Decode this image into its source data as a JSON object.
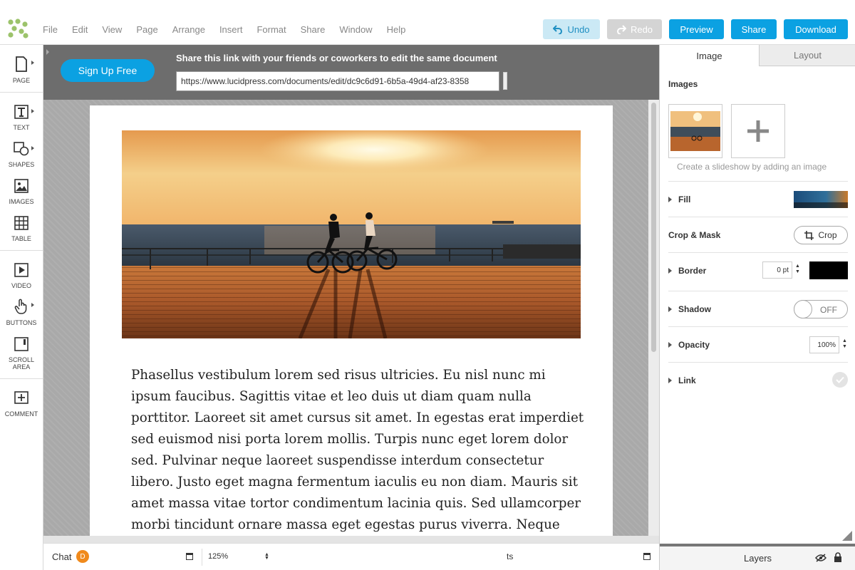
{
  "app": {
    "menu": [
      "File",
      "Edit",
      "View",
      "Page",
      "Arrange",
      "Insert",
      "Format",
      "Share",
      "Window",
      "Help"
    ],
    "buttons": {
      "undo": "Undo",
      "redo": "Redo",
      "preview": "Preview",
      "share": "Share",
      "download": "Download"
    }
  },
  "left_toolbar": {
    "page": "PAGE",
    "text": "TEXT",
    "shapes": "SHAPES",
    "images": "IMAGES",
    "table": "TABLE",
    "video": "VIDEO",
    "buttons": "BUTTONS",
    "scroll_area_line1": "SCROLL",
    "scroll_area_line2": "AREA",
    "comment": "COMMENT"
  },
  "share_banner": {
    "signup_label": "Sign Up Free",
    "message": "Share this link with your friends or coworkers to edit the same document",
    "link_value": "https://www.lucidpress.com/documents/edit/dc9c6d91-6b5a-49d4-af23-8358"
  },
  "document": {
    "body_text": "Phasellus vestibulum lorem sed risus ultricies. Eu nisl nunc mi ipsum faucibus. Sagittis vitae et leo duis ut diam quam nulla porttitor. Laoreet sit amet cursus sit amet. In egestas erat imperdiet sed euismod nisi porta lorem mollis. Turpis nunc eget lorem dolor sed. Pulvinar neque laoreet suspendisse interdum consectetur libero. Justo eget magna fermentum iaculis eu non diam. Mauris sit amet massa vitae tortor condimentum lacinia quis. Sed ullamcorper morbi tincidunt ornare massa eget egestas purus viverra. Neque volutpat ac"
  },
  "bottom_bar": {
    "chat_label": "Chat",
    "chat_badge": "D",
    "zoom": "125%",
    "ts_label": "ts"
  },
  "right_panel": {
    "tabs": {
      "image": "Image",
      "layout": "Layout"
    },
    "images_title": "Images",
    "slideshow_hint": "Create a slideshow by adding an image",
    "fill_label": "Fill",
    "crop_mask_label": "Crop & Mask",
    "crop_button": "Crop",
    "border_label": "Border",
    "border_value": "0 pt",
    "shadow_label": "Shadow",
    "shadow_state": "OFF",
    "opacity_label": "Opacity",
    "opacity_value": "100%",
    "link_label": "Link",
    "layers_label": "Layers"
  },
  "colors": {
    "accent": "#0ba1e2",
    "undo_bg": "#cbe9f5",
    "redo_bg": "#d4d4d4",
    "banner_bg": "#6d6d6d",
    "canvas_bg": "#a9a9a9",
    "chat_badge": "#f08a1c",
    "border_color": "#000000"
  }
}
